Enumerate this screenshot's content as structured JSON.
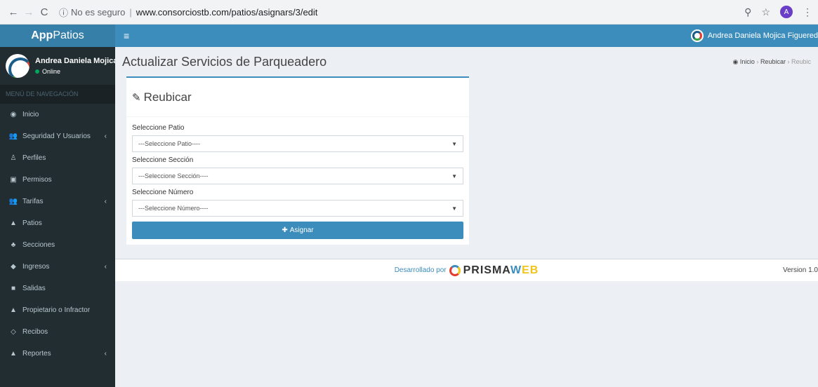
{
  "browser": {
    "back": "←",
    "forward": "→",
    "reload": "C",
    "security": "No es seguro",
    "url": "www.consorciostb.com/patios/asignars/3/edit",
    "avatar_letter": "A"
  },
  "sidebar": {
    "logo_bold": "App",
    "logo_rest": "Patios",
    "user_name": "Andrea Daniela Mojica F",
    "user_status": "Online",
    "nav_header": "MENÚ DE NAVEGACIÓN",
    "items": [
      {
        "label": "Inicio",
        "icon": "dashboard-icon",
        "chevron": ""
      },
      {
        "label": "Seguridad Y Usuarios",
        "icon": "users-icon",
        "chevron": "‹"
      },
      {
        "label": "Perfiles",
        "icon": "male-icon",
        "chevron": ""
      },
      {
        "label": "Permisos",
        "icon": "book-icon",
        "chevron": ""
      },
      {
        "label": "Tarifas",
        "icon": "users-icon",
        "chevron": "‹"
      },
      {
        "label": "Patios",
        "icon": "area-chart-icon",
        "chevron": ""
      },
      {
        "label": "Secciones",
        "icon": "child-icon",
        "chevron": ""
      },
      {
        "label": "Ingresos",
        "icon": "car-icon",
        "chevron": "‹"
      },
      {
        "label": "Salidas",
        "icon": "bus-icon",
        "chevron": ""
      },
      {
        "label": "Propietario o Infractor",
        "icon": "user-icon",
        "chevron": ""
      },
      {
        "label": "Recibos",
        "icon": "code-icon",
        "chevron": ""
      },
      {
        "label": "Reportes",
        "icon": "area-chart-icon",
        "chevron": "‹"
      }
    ]
  },
  "topbar": {
    "user_name": "Andrea Daniela Mojica Figuered"
  },
  "content": {
    "title": "Actualizar Servicios de Parqueadero",
    "breadcrumb": [
      "Inicio",
      "Reubicar",
      "Reubic"
    ]
  },
  "form": {
    "title": "Reubicar",
    "fields": [
      {
        "label": "Seleccione Patio",
        "value": "---Seleccione Patio----"
      },
      {
        "label": "Seleccione Sección",
        "value": "---Seleccione Sección----"
      },
      {
        "label": "Seleccione Número",
        "value": "---Seleccione Número----"
      }
    ],
    "submit": "Asignar"
  },
  "footer": {
    "developed_by": "Desarrollado por",
    "brand_a": "PRISMA",
    "brand_b": "W",
    "brand_c": "EB",
    "version": "Version 1.0"
  },
  "colors": {
    "primary": "#3c8dbc",
    "sidebar": "#222d32",
    "logo_bg": "#367fa9"
  }
}
